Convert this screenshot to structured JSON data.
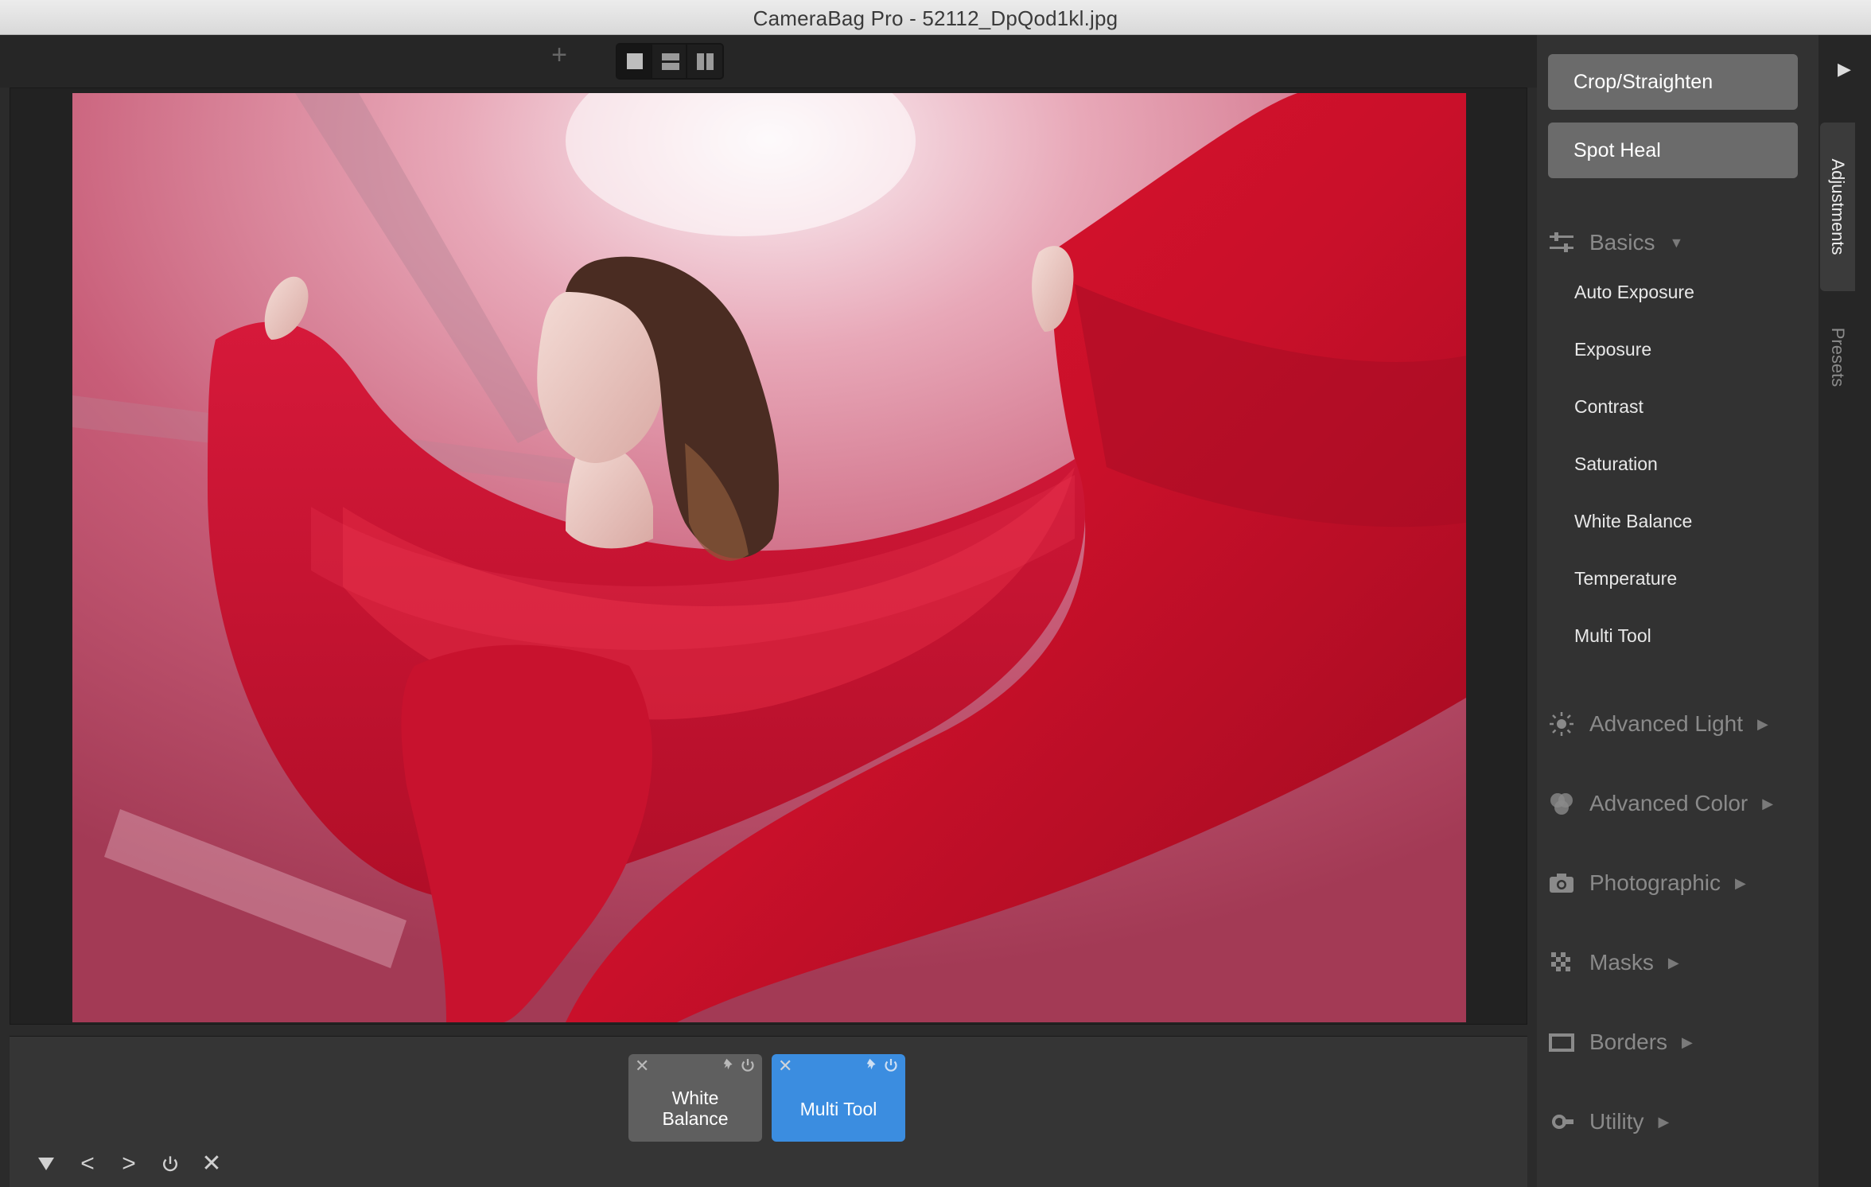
{
  "window": {
    "title": "CameraBag Pro - 52112_DpQod1kl.jpg"
  },
  "toolbar": {
    "add_icon": "plus-icon",
    "layouts": [
      "single-view-icon",
      "stacked-view-icon",
      "side-by-side-view-icon"
    ],
    "active_layout": "single-view-icon"
  },
  "viewer": {
    "image_description_icon": "photo-woman-red-fabric"
  },
  "filmstrip": {
    "chips": [
      {
        "label": "White\nBalance",
        "state": "inactive"
      },
      {
        "label": "Multi Tool",
        "state": "selected"
      }
    ],
    "controls": [
      "collapse-icon",
      "previous-icon",
      "next-icon",
      "power-icon",
      "close-icon"
    ]
  },
  "panel": {
    "crop_label": "Crop/Straighten",
    "heal_label": "Spot Heal",
    "basics": {
      "label": "Basics",
      "items": [
        "Auto Exposure",
        "Exposure",
        "Contrast",
        "Saturation",
        "White Balance",
        "Temperature",
        "Multi Tool"
      ]
    },
    "sections": [
      "Advanced Light",
      "Advanced Color",
      "Photographic",
      "Masks",
      "Borders",
      "Utility"
    ]
  },
  "side_tabs": {
    "adjustments": "Adjustments",
    "presets": "Presets"
  },
  "colors": {
    "accent": "#3b8de0",
    "panel": "#323232",
    "background": "#2b2b2b"
  }
}
